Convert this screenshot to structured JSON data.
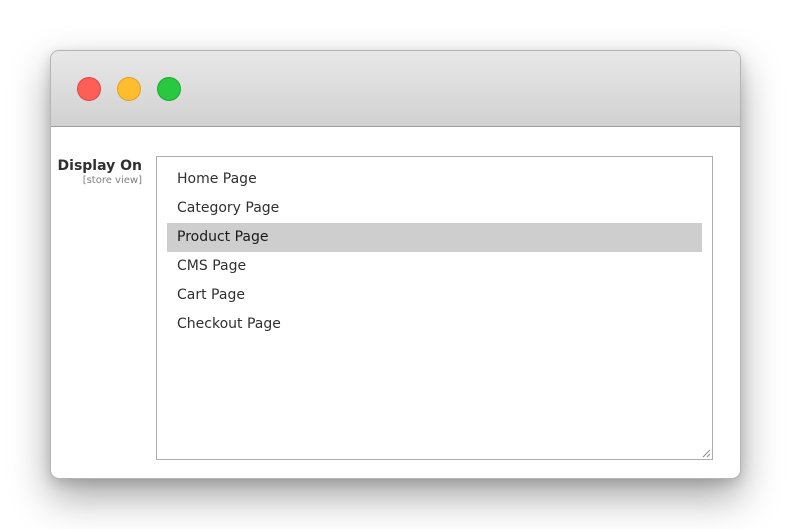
{
  "window": {
    "buttons": {
      "close": "close-icon",
      "minimize": "minimize-icon",
      "maximize": "maximize-icon"
    }
  },
  "field": {
    "label": "Display On",
    "scope": "[store view]",
    "options": [
      {
        "label": "Home Page",
        "selected": false
      },
      {
        "label": "Category Page",
        "selected": false
      },
      {
        "label": "Product Page",
        "selected": true
      },
      {
        "label": "CMS Page",
        "selected": false
      },
      {
        "label": "Cart Page",
        "selected": false
      },
      {
        "label": "Checkout Page",
        "selected": false
      }
    ]
  },
  "colors": {
    "close": "#fd5f57",
    "minimize": "#febc2e",
    "maximize": "#28c840",
    "selected_option_bg": "#cecece"
  }
}
